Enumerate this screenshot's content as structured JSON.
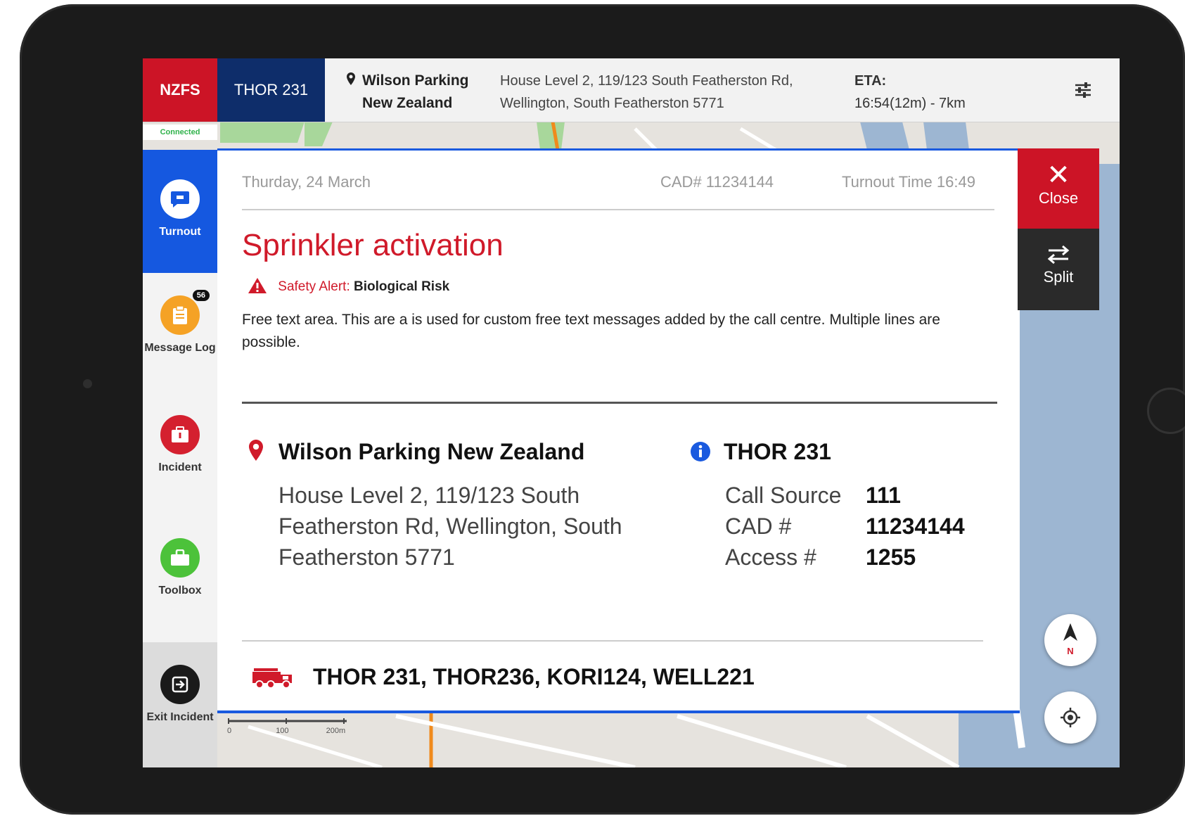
{
  "topbar": {
    "brand": "NZFS",
    "unit": "THOR 231",
    "location_line1": "Wilson Parking",
    "location_line2": "New Zealand",
    "address": "House Level 2, 119/123 South Featherston Rd, Wellington, South Featherston 5771",
    "eta_label": "ETA:",
    "eta_value": "16:54(12m) - 7km",
    "settings_icon": "sliders-icon"
  },
  "status": {
    "connection": "Connected"
  },
  "sidebar": {
    "items": [
      {
        "label": "Turnout",
        "icon": "chat-icon",
        "active": true
      },
      {
        "label": "Message Log",
        "icon": "clipboard-icon",
        "badge": "56"
      },
      {
        "label": "Incident",
        "icon": "incident-icon"
      },
      {
        "label": "Toolbox",
        "icon": "toolbox-icon"
      },
      {
        "label": "Exit Incident",
        "icon": "exit-icon"
      }
    ]
  },
  "incident": {
    "date": "Thurday, 24 March",
    "cad_header": "CAD# 11234144",
    "turnout_time": "Turnout Time 16:49",
    "title": "Sprinkler activation",
    "safety_label": "Safety Alert:",
    "safety_value": "Biological Risk",
    "free_text": "Free text area. This are a is used for custom free text messages added by the call centre. Multiple lines are possible.",
    "location_name": "Wilson Parking New Zealand",
    "location_address": "House Level 2, 119/123 South Featherston Rd, Wellington, South Featherston 5771",
    "unit_name": "THOR 231",
    "details": [
      {
        "key": "Call Source",
        "value": "111"
      },
      {
        "key": "CAD #",
        "value": "11234144"
      },
      {
        "key": "Access #",
        "value": "1255"
      }
    ],
    "responding_units": "THOR 231, THOR236, KORI124, WELL221"
  },
  "actions": {
    "close": "Close",
    "split": "Split"
  },
  "map": {
    "compass_label": "N",
    "scale_labels": [
      "0",
      "100",
      "200m"
    ]
  },
  "colors": {
    "brand_red": "#cc1426",
    "navy": "#0e2d6a",
    "active_blue": "#1558e0",
    "alert_red": "#d01a2a"
  }
}
